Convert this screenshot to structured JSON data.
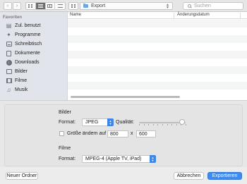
{
  "toolbar": {
    "back_icon": "chevron-left",
    "forward_icon": "chevron-right",
    "view_modes": [
      "icon-view",
      "list-view",
      "column-view",
      "coverflow-view"
    ],
    "active_view": "list-view",
    "arrange_icon": "arrange-menu",
    "location": "Export",
    "search_placeholder": "Suchen"
  },
  "sidebar": {
    "section_title": "Favoriten",
    "items": [
      {
        "label": "Zul. benutzt",
        "icon": "recent-icon"
      },
      {
        "label": "Programme",
        "icon": "applications-icon"
      },
      {
        "label": "Schreibtisch",
        "icon": "desktop-icon"
      },
      {
        "label": "Dokumente",
        "icon": "documents-icon"
      },
      {
        "label": "Downloads",
        "icon": "downloads-icon"
      },
      {
        "label": "Bilder",
        "icon": "pictures-icon"
      },
      {
        "label": "Filme",
        "icon": "movies-icon"
      },
      {
        "label": "Musik",
        "icon": "music-icon"
      }
    ]
  },
  "file_list": {
    "columns": [
      "Name",
      "Änderungsdatum"
    ],
    "rows": [],
    "scrollbar_fraction": 0.62
  },
  "options": {
    "images": {
      "title": "Bilder",
      "format_label": "Format:",
      "format_value": "JPEG",
      "quality_label": "Qualität:",
      "quality_fraction": 0.92,
      "resize_label": "Größe ändern auf",
      "resize_checked": false,
      "width": "800",
      "times": "x",
      "height": "600"
    },
    "movies": {
      "title": "Filme",
      "format_label": "Format:",
      "format_value": "MPEG-4 (Apple TV, iPad)"
    }
  },
  "buttons": {
    "new_folder": "Neuer Ordner",
    "cancel": "Abbrechen",
    "export": "Exportieren"
  },
  "colors": {
    "accent": "#3f8af0",
    "sidebar_bg": "#e1e4ea"
  }
}
